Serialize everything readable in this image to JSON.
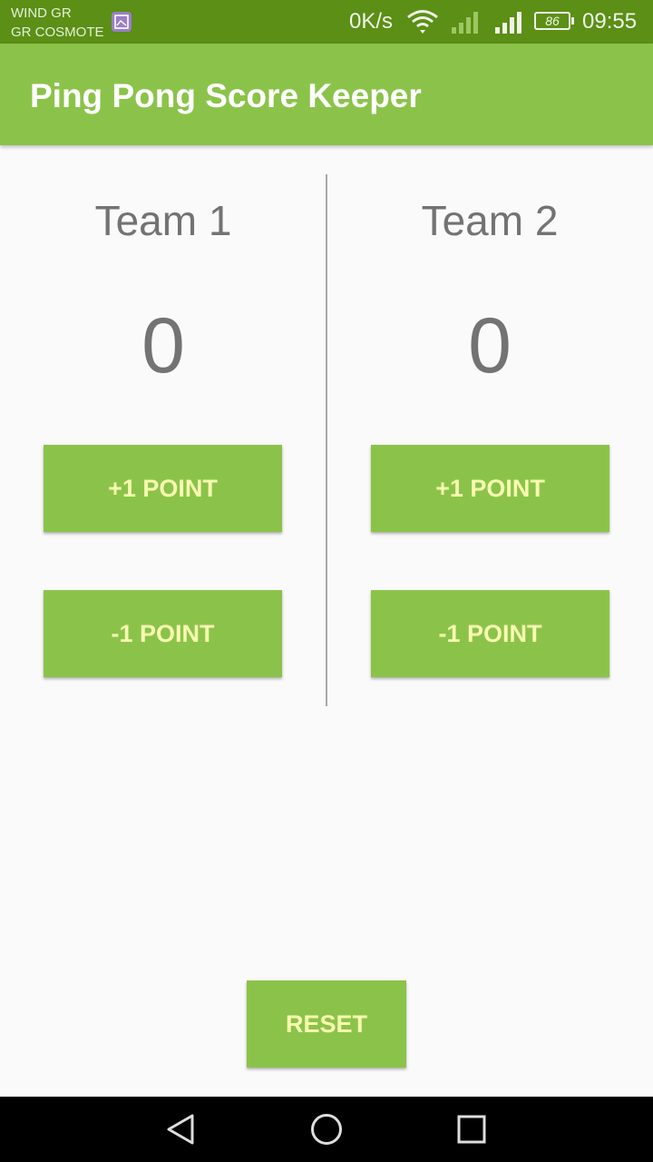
{
  "status_bar": {
    "carrier_1": "WIND GR",
    "carrier_2": "GR COSMOTE",
    "speed": "0K/s",
    "battery": "86",
    "time": "09:55"
  },
  "app_bar": {
    "title": "Ping Pong Score Keeper"
  },
  "teams": [
    {
      "name": "Team 1",
      "score": "0",
      "plus_label": "+1 POINT",
      "minus_label": "-1 POINT"
    },
    {
      "name": "Team 2",
      "score": "0",
      "plus_label": "+1 POINT",
      "minus_label": "-1 POINT"
    }
  ],
  "reset_label": "RESET",
  "colors": {
    "primary": "#8bc34a",
    "primary_dark": "#5b8f16",
    "button_text": "#f7fcb0",
    "text_grey": "#737373"
  },
  "icons": {
    "status": [
      "image-notification-icon",
      "wifi-icon",
      "signal-icon",
      "signal-icon",
      "battery-icon"
    ],
    "nav": [
      "back-icon",
      "home-icon",
      "recents-icon"
    ]
  }
}
